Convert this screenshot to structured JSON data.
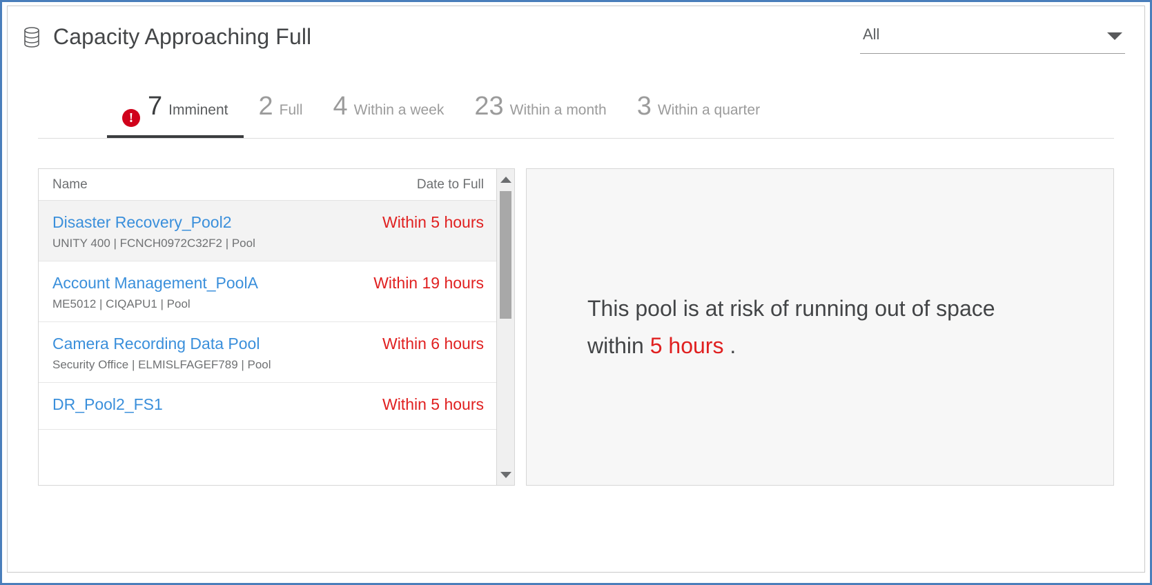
{
  "header": {
    "title": "Capacity Approaching Full",
    "icon": "database-icon",
    "filter": {
      "value": "All",
      "arrow_icon": "chevron-down-icon"
    }
  },
  "tabs": [
    {
      "count": "7",
      "label": "Imminent",
      "active": true,
      "badge": "!",
      "badge_color": "#d0021b"
    },
    {
      "count": "2",
      "label": "Full",
      "active": false
    },
    {
      "count": "4",
      "label": "Within a week",
      "active": false
    },
    {
      "count": "23",
      "label": "Within a month",
      "active": false
    },
    {
      "count": "3",
      "label": "Within a quarter",
      "active": false
    }
  ],
  "list": {
    "columns": {
      "name": "Name",
      "date": "Date to Full"
    },
    "rows": [
      {
        "name": "Disaster Recovery_Pool2",
        "date": "Within 5 hours",
        "subtitle": "UNITY 400 | FCNCH0972C32F2 | Pool",
        "selected": true
      },
      {
        "name": "Account Management_PoolA",
        "date": "Within 19 hours",
        "subtitle": "ME5012 | CIQAPU1 | Pool",
        "selected": false
      },
      {
        "name": "Camera Recording Data Pool",
        "date": "Within 6 hours",
        "subtitle": "Security Office | ELMISLFAGEF789 | Pool",
        "selected": false
      },
      {
        "name": "DR_Pool2_FS1",
        "date": "Within 5 hours",
        "subtitle": "",
        "selected": false
      }
    ],
    "scrollbar": {
      "up_icon": "caret-up-icon",
      "down_icon": "caret-down-icon"
    }
  },
  "detail": {
    "text_before": "This pool is at risk of running out of space within ",
    "highlight": "5 hours",
    "text_after": " ."
  },
  "colors": {
    "link": "#3a8fdb",
    "danger": "#e02020",
    "accent": "#d0021b",
    "frame": "#4a7ebb"
  }
}
